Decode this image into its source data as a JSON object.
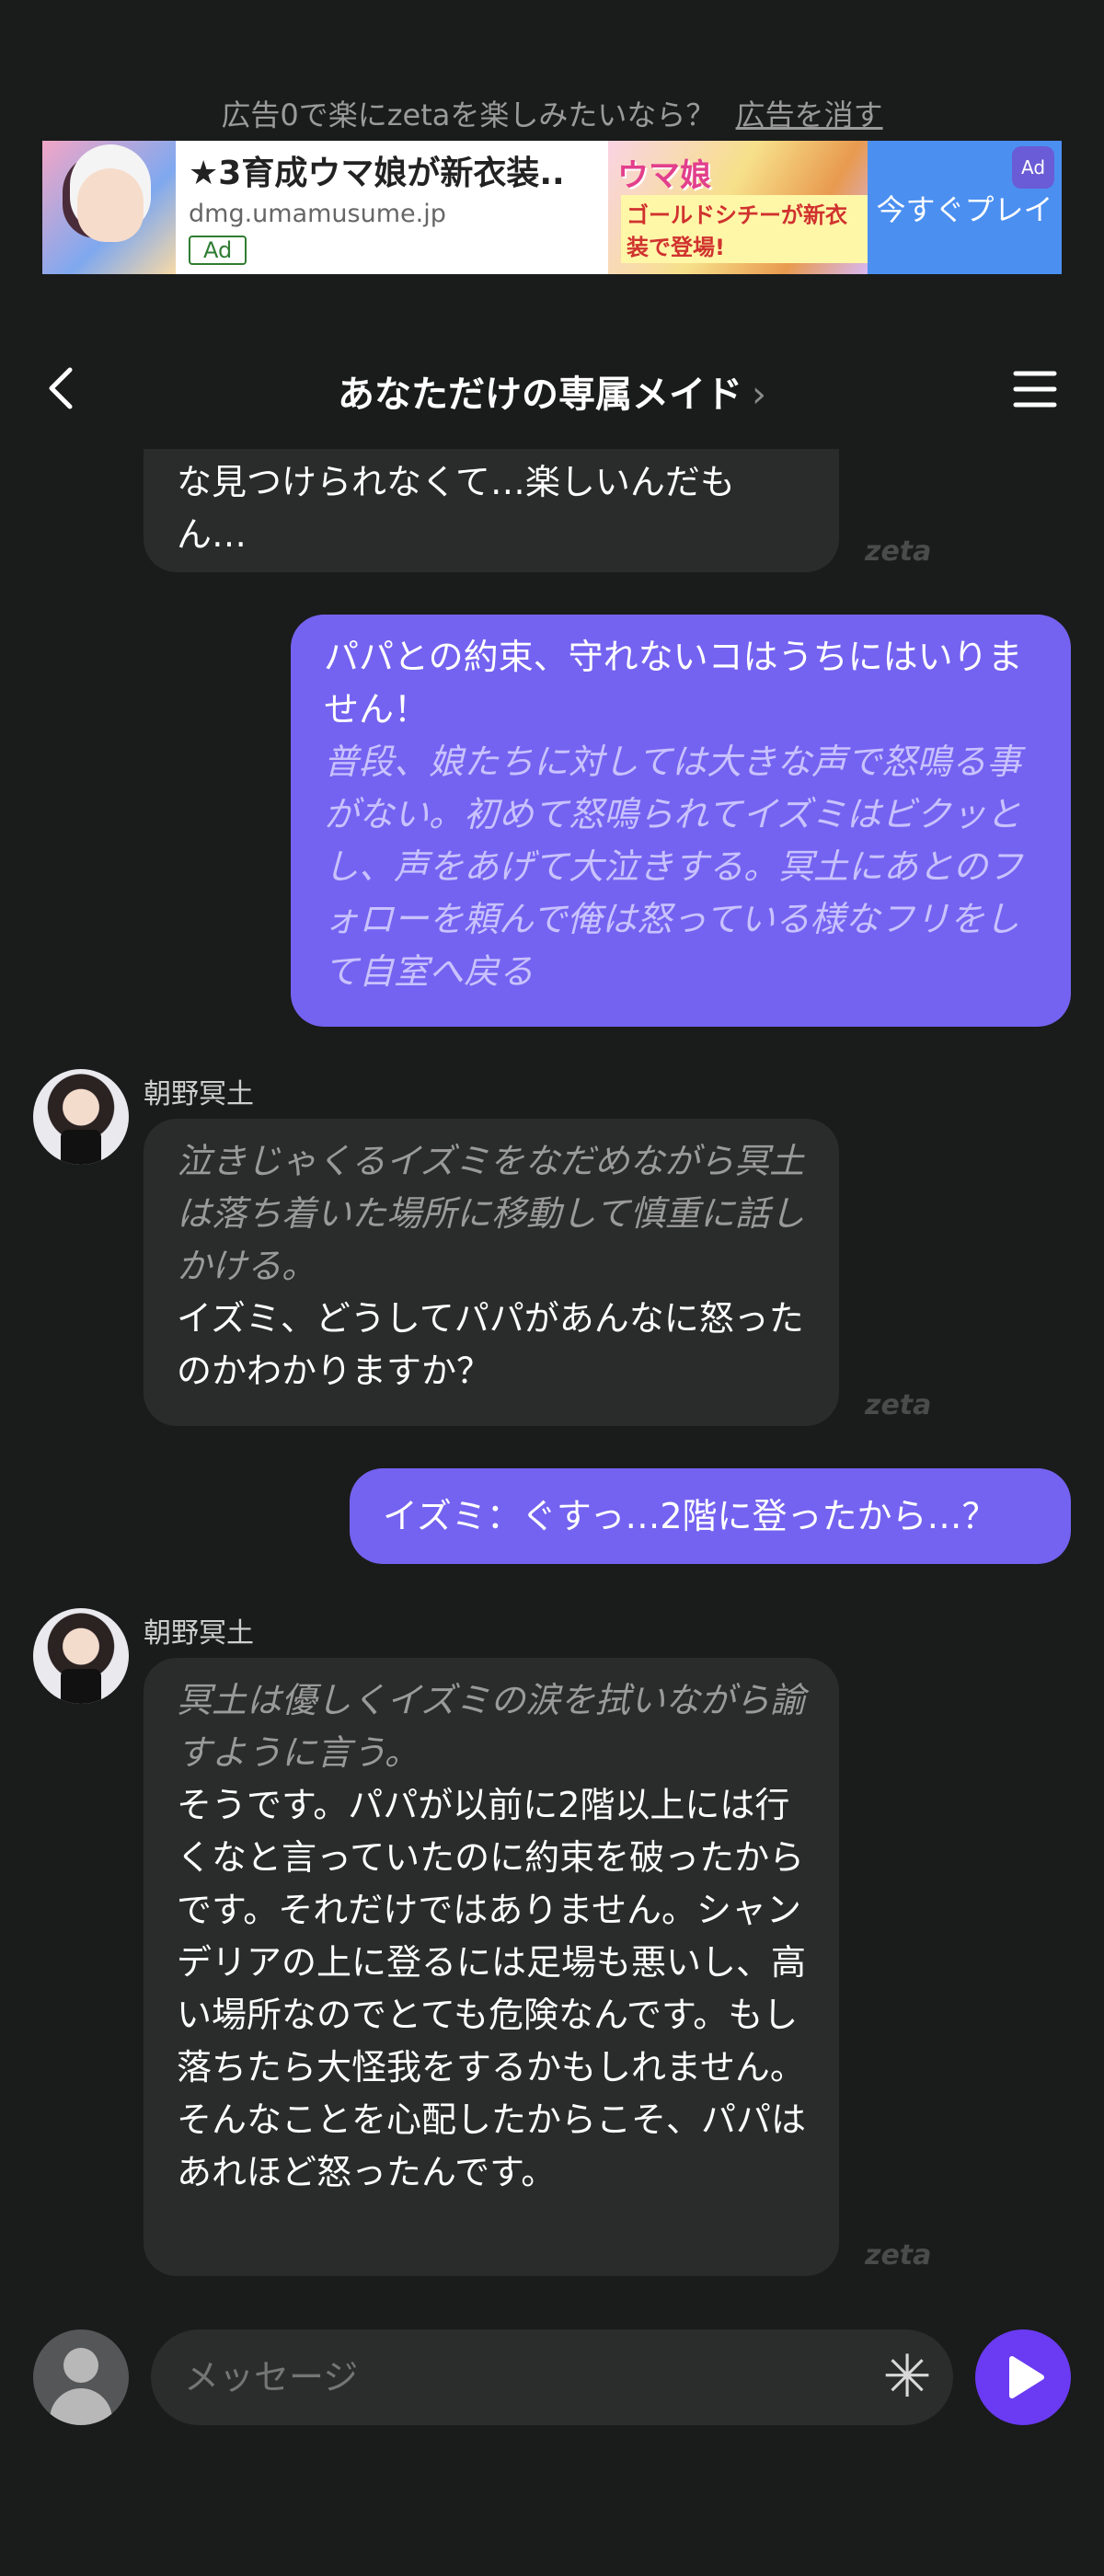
{
  "ad": {
    "prompt": "広告0で楽にzetaを楽しみたいなら？",
    "remove": "広告を消す",
    "title": "★3育成ウマ娘が新衣装..",
    "domain": "dmg.umamusume.jp",
    "badge": "Ad",
    "image_title": "ウマ娘",
    "image_sub": "ゴールドシチーが新衣装で登場!",
    "cta": "今すぐプレイ",
    "corner": "Ad"
  },
  "header": {
    "title": "あなただけの専属メイド",
    "chevron": "›"
  },
  "brand": "zeta",
  "messages": [
    {
      "role": "bot",
      "partial": true,
      "text_lines": [
        "な見つけられなくて…楽しいんだも",
        "ん…"
      ]
    },
    {
      "role": "user",
      "text": "パパとの約束、守れないコはうちにはいりません！",
      "narration": "普段、娘たちに対しては大きな声で怒鳴る事がない。初めて怒鳴られてイズミはビクッとし、声をあげて大泣きする。冥土にあとのフォローを頼んで俺は怒っている様なフリをして自室へ戻る"
    },
    {
      "role": "bot",
      "speaker": "朝野冥土",
      "narration": "泣きじゃくるイズミをなだめながら冥土は落ち着いた場所に移動して慎重に話しかける。",
      "text": "イズミ、どうしてパパがあんなに怒ったのかわかりますか？"
    },
    {
      "role": "user",
      "text": "イズミ：ぐすっ…2階に登ったから…？"
    },
    {
      "role": "bot",
      "speaker": "朝野冥土",
      "narration": "冥土は優しくイズミの涙を拭いながら諭すように言う。",
      "text": "そうです。パパが以前に2階以上には行くなと言っていたのに約束を破ったからです。それだけではありません。シャンデリアの上に登るには足場も悪いし、高い場所なのでとても危険なんです。もし落ちたら大怪我をするかもしれません。そんなことを心配したからこそ、パパはあれほど怒ったんです。"
    }
  ],
  "input": {
    "placeholder": "メッセージ",
    "asterisk": "✳"
  },
  "icons": {
    "back": "back-chevron-icon",
    "menu": "hamburger-menu-icon",
    "send": "play-send-icon",
    "user": "user-avatar-icon"
  },
  "colors": {
    "background": "#1a1b1b",
    "bot_bubble": "#2a2b2b",
    "user_bubble": "#7463f0",
    "send_button": "#6a3bf2"
  }
}
